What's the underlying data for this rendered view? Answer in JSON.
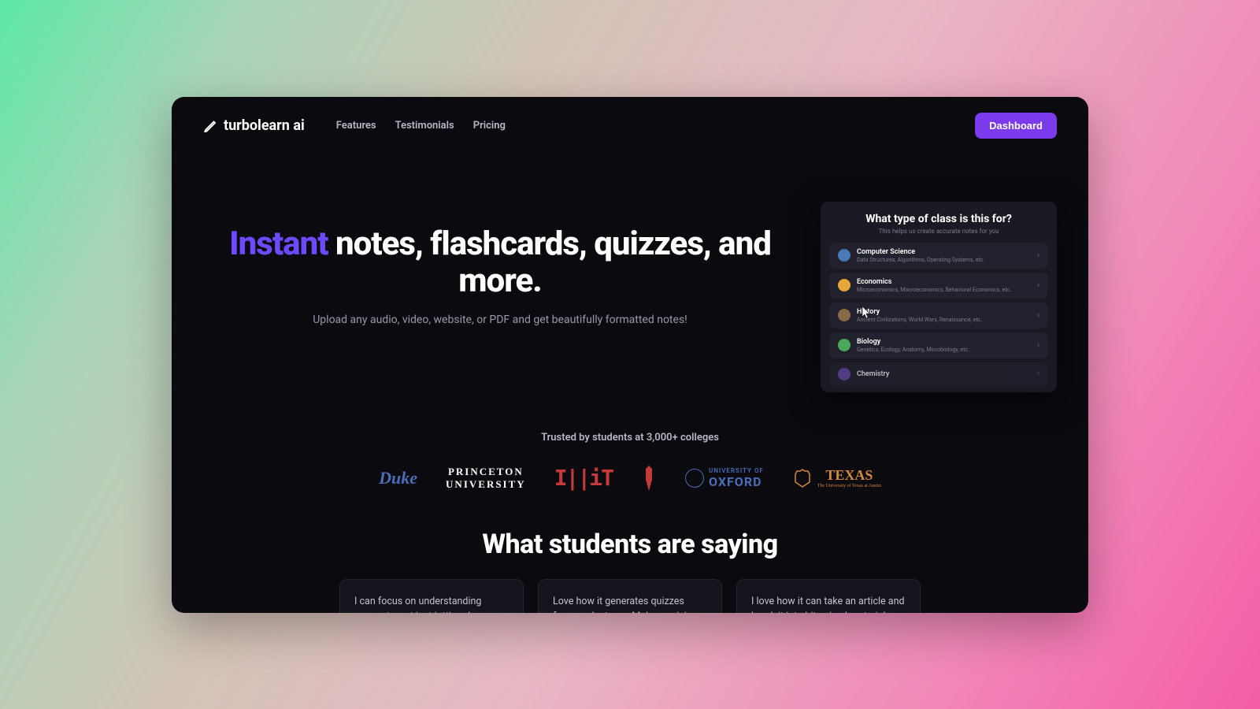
{
  "brand": "turbolearn ai",
  "nav": {
    "features": "Features",
    "testimonials": "Testimonials",
    "pricing": "Pricing",
    "dashboard": "Dashboard"
  },
  "hero": {
    "accent": "Instant",
    "rest": " notes, flashcards, quizzes, and more.",
    "sub": "Upload any audio, video, website, or PDF and get beautifully formatted notes!"
  },
  "modal": {
    "title": "What type of class is this for?",
    "sub": "This helps us create accurate notes for you",
    "items": [
      {
        "name": "Computer Science",
        "desc": "Data Structures, Algorithms, Operating Systems, etc.",
        "color": "#4a7ab8"
      },
      {
        "name": "Economics",
        "desc": "Microeconomics, Macroeconomics, Behavioral Economics, etc.",
        "color": "#e8a838"
      },
      {
        "name": "History",
        "desc": "Ancient Civilizations, World Wars, Renaissance, etc.",
        "color": "#8a6a4a"
      },
      {
        "name": "Biology",
        "desc": "Genetics, Ecology, Anatomy, Microbiology, etc.",
        "color": "#4aa858"
      },
      {
        "name": "Chemistry",
        "desc": "",
        "color": "#6a4aa8"
      }
    ]
  },
  "trusted": "Trusted by students at 3,000+ colleges",
  "universities": {
    "duke": "Duke",
    "princeton_top": "PRINCETON",
    "princeton_bot": "UNIVERSITY",
    "mit": "I||iT",
    "oxford_top": "UNIVERSITY OF",
    "oxford_bot": "OXFORD",
    "texas": "TEXAS",
    "texas_sub": "The University of Texas at Austin"
  },
  "testimonials_heading": "What students are saying",
  "testimonials": [
    "I can focus on understanding concepts, not just jotting down notes. It's like having a personal study assistant.",
    "Love how it generates quizzes from my lectures. Makes revising so much more efficient and less stressful.",
    "I love how it can take an article and break it into bite-sized materials. Reading academic articles feels less daunting"
  ]
}
